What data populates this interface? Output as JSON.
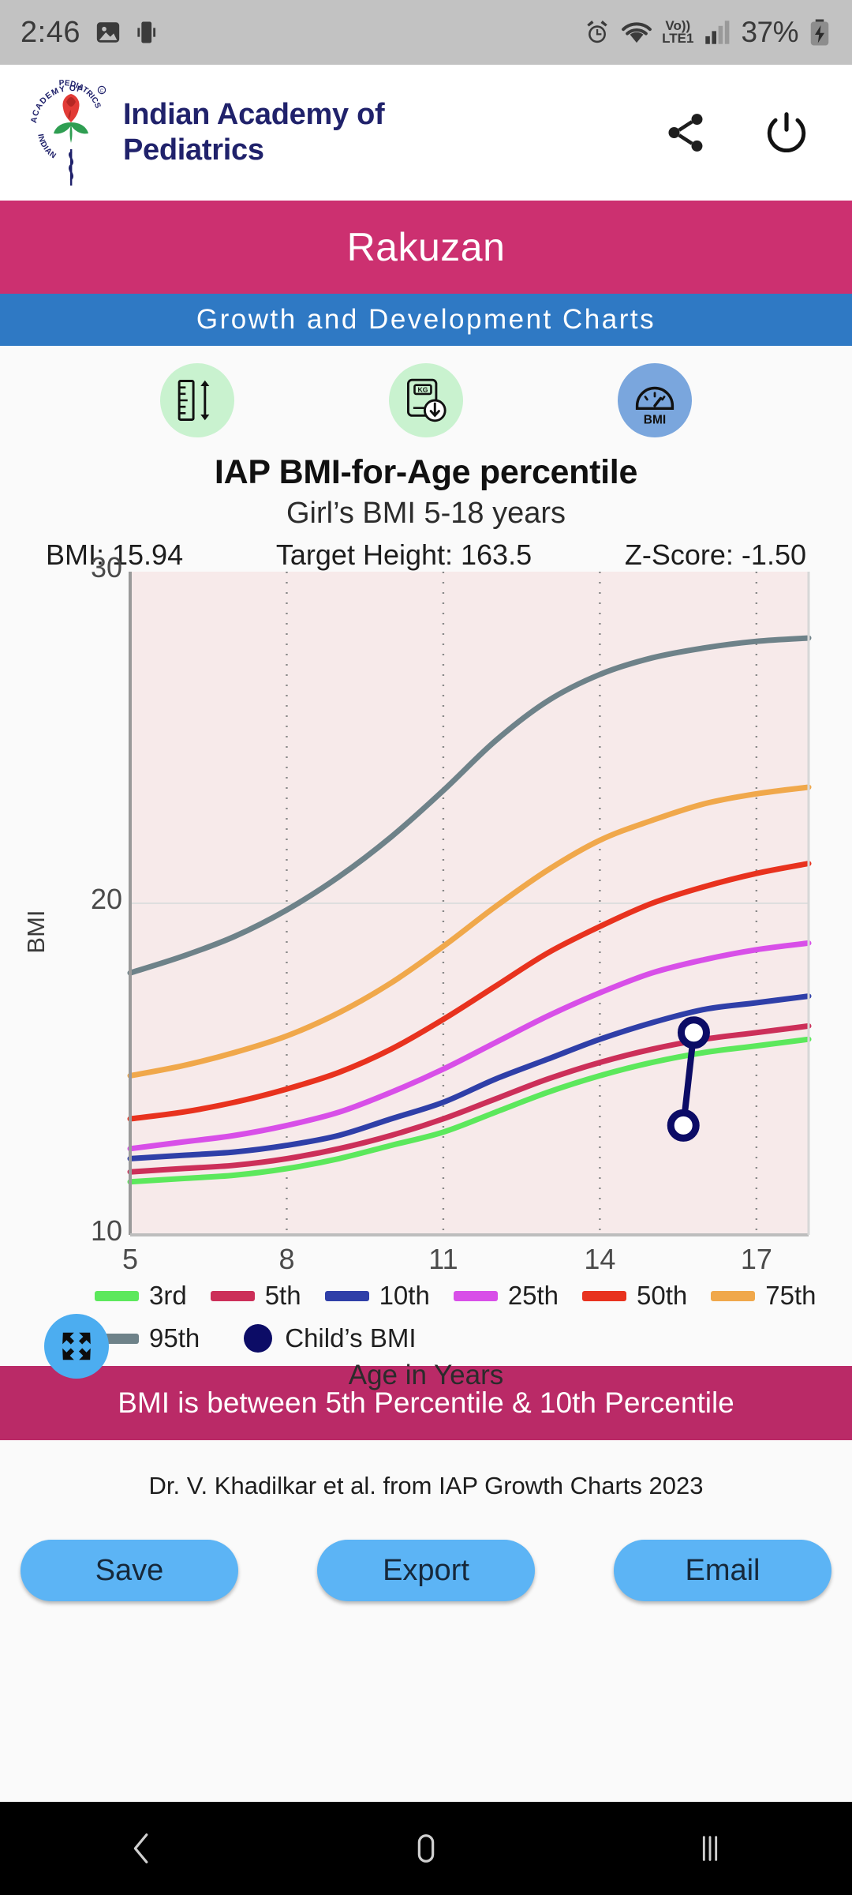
{
  "status_bar": {
    "time": "2:46",
    "battery_percent": "37%",
    "network_label_top": "Vo))",
    "network_label_bottom": "LTE1",
    "icons": [
      "image-icon",
      "phone-vibrate-icon",
      "alarm-icon",
      "wifi-icon",
      "volte-icon",
      "signal-icon",
      "battery-charging-icon"
    ]
  },
  "app_header": {
    "brand_line1": "Indian Academy of",
    "brand_line2": "Pediatrics",
    "logo_alt": "iap-rose-logo",
    "share_icon": "share-icon",
    "power_icon": "power-icon"
  },
  "patient": {
    "name": "Rakuzan"
  },
  "section": {
    "title": "Growth and Development Charts"
  },
  "tabs": [
    {
      "id": "height",
      "icon": "height-ruler-icon",
      "selected": false
    },
    {
      "id": "weight",
      "icon": "weight-scale-kg-icon",
      "selected": false
    },
    {
      "id": "bmi",
      "icon": "bmi-gauge-icon",
      "label": "BMI",
      "selected": true
    }
  ],
  "chart_header": {
    "title": "IAP BMI-for-Age percentile",
    "subtitle": "Girl’s BMI 5-18 years",
    "stats": [
      {
        "label": "BMI:",
        "value": "15.94",
        "text": "BMI: 15.94"
      },
      {
        "label": "Target Height:",
        "value": "163.5",
        "text": "Target Height: 163.5"
      },
      {
        "label": "Z-Score:",
        "value": "-1.50",
        "text": "Z-Score: -1.50"
      }
    ]
  },
  "chart_data": {
    "type": "line",
    "title": "IAP BMI-for-Age percentile",
    "subtitle": "Girl’s BMI 5-18 years",
    "xlabel": "Age in Years",
    "ylabel": "BMI",
    "xlim": [
      5,
      18
    ],
    "ylim": [
      10,
      30
    ],
    "xticks": [
      5,
      8,
      11,
      14,
      17
    ],
    "yticks": [
      10,
      20,
      30
    ],
    "grid": "dotted vertical at xticks, solid horizontal at y=20",
    "legend_position": "below-plot",
    "plot_background": "#f7eaea",
    "x": [
      5,
      6,
      7,
      8,
      9,
      10,
      11,
      12,
      13,
      14,
      15,
      16,
      17,
      18
    ],
    "series": [
      {
        "name": "3rd",
        "color": "#5CE85C",
        "values": [
          11.6,
          11.7,
          11.8,
          12.0,
          12.3,
          12.7,
          13.1,
          13.7,
          14.3,
          14.8,
          15.2,
          15.5,
          15.7,
          15.9
        ]
      },
      {
        "name": "5th",
        "color": "#CC2F59",
        "values": [
          11.9,
          12.0,
          12.1,
          12.3,
          12.6,
          13.0,
          13.5,
          14.1,
          14.7,
          15.2,
          15.6,
          15.9,
          16.1,
          16.3
        ]
      },
      {
        "name": "10th",
        "color": "#2F3FA8",
        "values": [
          12.3,
          12.4,
          12.5,
          12.7,
          13.0,
          13.5,
          14.0,
          14.7,
          15.3,
          15.9,
          16.4,
          16.8,
          17.0,
          17.2
        ]
      },
      {
        "name": "25th",
        "color": "#D84FE8",
        "values": [
          12.6,
          12.8,
          13.0,
          13.3,
          13.7,
          14.3,
          15.0,
          15.8,
          16.6,
          17.3,
          17.9,
          18.3,
          18.6,
          18.8
        ]
      },
      {
        "name": "50th",
        "color": "#E8321E",
        "values": [
          13.5,
          13.7,
          14.0,
          14.4,
          14.9,
          15.6,
          16.5,
          17.5,
          18.5,
          19.3,
          20.0,
          20.5,
          20.9,
          21.2
        ]
      },
      {
        "name": "75th",
        "color": "#F0A84B",
        "values": [
          14.8,
          15.1,
          15.5,
          16.0,
          16.7,
          17.6,
          18.7,
          19.9,
          21.0,
          21.9,
          22.5,
          23.0,
          23.3,
          23.5
        ]
      },
      {
        "name": "95th",
        "color": "#6E8289",
        "values": [
          17.9,
          18.4,
          19.0,
          19.8,
          20.8,
          22.0,
          23.4,
          24.9,
          26.1,
          26.9,
          27.4,
          27.7,
          27.9,
          28.0
        ]
      }
    ],
    "child_points": {
      "name": "Child’s BMI",
      "color": "#0C0C66",
      "points": [
        {
          "age": 15.8,
          "bmi": 16.1
        },
        {
          "age": 15.6,
          "bmi": 13.3
        }
      ]
    }
  },
  "legend": {
    "rows": [
      [
        {
          "label": "3rd",
          "color": "#5CE85C",
          "shape": "line"
        },
        {
          "label": "5th",
          "color": "#CC2F59",
          "shape": "line"
        },
        {
          "label": "10th",
          "color": "#2F3FA8",
          "shape": "line"
        },
        {
          "label": "25th",
          "color": "#D84FE8",
          "shape": "line"
        },
        {
          "label": "50th",
          "color": "#E8321E",
          "shape": "line"
        },
        {
          "label": "75th",
          "color": "#F0A84B",
          "shape": "line"
        }
      ],
      [
        {
          "label": "95th",
          "color": "#6E8289",
          "shape": "line"
        },
        {
          "label": "Child’s BMI",
          "color": "#0C0C66",
          "shape": "dot"
        }
      ]
    ]
  },
  "result_banner": {
    "text": "BMI is between 5th Percentile & 10th Percentile",
    "color": "#ba2a67"
  },
  "credit": {
    "text": "Dr. V. Khadilkar et al. from IAP Growth Charts 2023"
  },
  "actions": [
    {
      "id": "save",
      "label": "Save"
    },
    {
      "id": "export",
      "label": "Export"
    },
    {
      "id": "email",
      "label": "Email"
    }
  ],
  "fullscreen_button": {
    "icon": "fullscreen-expand-icon"
  },
  "nav_bar": {
    "back": "back-chevron-icon",
    "home": "home-circle-icon",
    "recents": "recents-icon"
  },
  "colors": {
    "brand_navy": "#20226b",
    "name_band": "#cc3070",
    "section_band": "#2f79c4",
    "result_band": "#ba2a67",
    "button_blue": "#5cb4f5",
    "plot_bg": "#f7eaea"
  }
}
